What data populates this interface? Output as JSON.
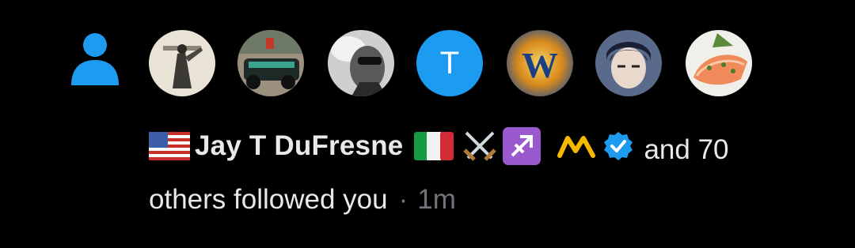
{
  "notification": {
    "type": "follow",
    "accent_color": "#1d9bf0",
    "avatar_letter": "T",
    "avatars": [
      "avatar-1",
      "avatar-2",
      "avatar-3",
      "avatar-4-letter",
      "avatar-5",
      "avatar-6",
      "avatar-7"
    ],
    "user": {
      "name": "Jay T DuFresne",
      "name_prefix_emoji": "us-flag-icon",
      "suffix_emojis": [
        "italy-flag-icon",
        "crossed-swords-icon",
        "sagittarius-icon",
        "yellow-m-icon"
      ],
      "verified": true
    },
    "and_text": "and 70",
    "others_text": "others followed you",
    "separator": "·",
    "timestamp": "1m"
  }
}
